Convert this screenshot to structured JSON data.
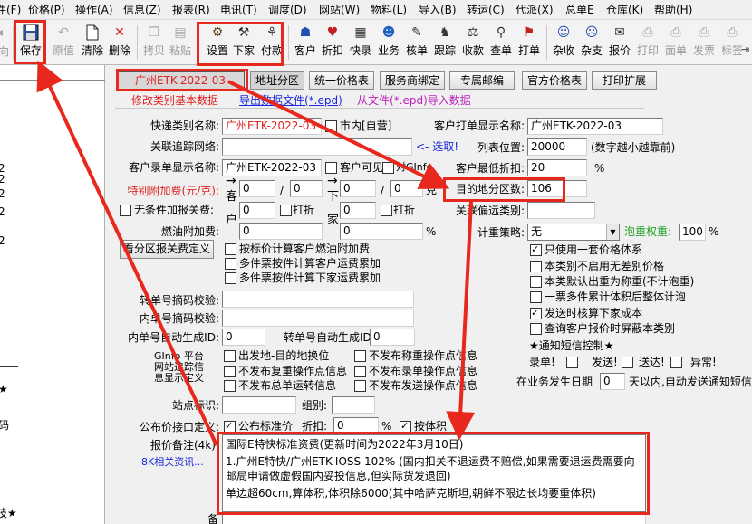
{
  "menu": [
    "件(F)",
    "价格(P)",
    "操作(A)",
    "信息(Z)",
    "报表(R)",
    "电讯(T)",
    "调度(D)",
    "网站(W)",
    "物料(L)",
    "导入(B)",
    "转运(C)",
    "代派(X)",
    "总单E",
    "仓库(K)",
    "帮助(H)"
  ],
  "toolbar": {
    "left_partial": "向",
    "buttons": [
      {
        "label": "保存",
        "icon": "floppy-icon",
        "enabled": true
      },
      {
        "label": "原值",
        "icon": "restore-icon",
        "enabled": false
      },
      {
        "label": "清除",
        "icon": "new-doc-icon",
        "enabled": true
      },
      {
        "label": "删除",
        "icon": "delete-icon",
        "enabled": true
      },
      {
        "label": "拷贝",
        "icon": "copy-icon",
        "enabled": false
      },
      {
        "label": "粘贴",
        "icon": "paste-icon",
        "enabled": false
      },
      {
        "label": "设置",
        "icon": "settings-icon",
        "enabled": true
      },
      {
        "label": "下家",
        "icon": "downstream-icon",
        "enabled": true
      },
      {
        "label": "付款",
        "icon": "payment-icon",
        "enabled": true
      },
      {
        "label": "客户",
        "icon": "customer-icon",
        "enabled": true
      },
      {
        "label": "折扣",
        "icon": "discount-icon",
        "enabled": true
      },
      {
        "label": "快录",
        "icon": "quick-entry-icon",
        "enabled": true
      },
      {
        "label": "业务",
        "icon": "business-icon",
        "enabled": true
      },
      {
        "label": "核单",
        "icon": "verify-icon",
        "enabled": true
      },
      {
        "label": "跟踪",
        "icon": "track-icon",
        "enabled": true
      },
      {
        "label": "收款",
        "icon": "receive-icon",
        "enabled": true
      },
      {
        "label": "查单",
        "icon": "query-icon",
        "enabled": true
      },
      {
        "label": "打单",
        "icon": "print-order-icon",
        "enabled": true
      },
      {
        "label": "杂收",
        "icon": "misc-income-icon",
        "enabled": true
      },
      {
        "label": "杂支",
        "icon": "misc-expense-icon",
        "enabled": true
      },
      {
        "label": "报价",
        "icon": "quote-icon",
        "enabled": true
      },
      {
        "label": "打印",
        "icon": "printer-icon",
        "enabled": false
      },
      {
        "label": "面单",
        "icon": "waybill-icon",
        "enabled": false
      },
      {
        "label": "发票",
        "icon": "invoice-icon",
        "enabled": false
      },
      {
        "label": "标签",
        "icon": "label-icon",
        "enabled": false
      }
    ]
  },
  "left_panel": {
    "fragments": [
      "2",
      "2",
      "2",
      "2",
      "2",
      "★",
      "码",
      "技★"
    ]
  },
  "tabs": {
    "current": "广州ETK-2022-03",
    "buttons": [
      "地址分区",
      "统一价格表",
      "服务商绑定",
      "专属邮编",
      "官方价格表",
      "打印扩展"
    ]
  },
  "links": {
    "edit_basic": "修改类别基本数据",
    "export": "导出数据文件(*.epd)",
    "import": "从文件(*.epd)导入数据"
  },
  "form": {
    "category_name_label": "快递类别名称:",
    "category_name": "广州ETK-2022-03",
    "city_internal_label": "市内[自营]",
    "print_name_label": "客户打单显示名称:",
    "print_name": "广州ETK-2022-03",
    "tracking_net_label": "关联追踪网络:",
    "tracking_net": "",
    "select_link": "<- 选取!",
    "list_pos_label": "列表位置:",
    "list_pos": "20000",
    "list_pos_hint": "(数字越小越靠前)",
    "entry_name_label": "客户录单显示名称:",
    "entry_name": "广州ETK-2022-03",
    "customer_visible_label": "客户可见",
    "ginfo_label": "对GInfo",
    "min_discount_label": "客户最低折扣:",
    "min_discount": "20",
    "percent": "%",
    "surcharge_label": "特别附加费(元/克):",
    "customer_short": "客",
    "downstream_short": "下",
    "surcharge_inputs": [
      "0",
      "0",
      "0",
      "0"
    ],
    "slash": "/",
    "gram": "克",
    "dest_zone_label": "目的地分区数:",
    "dest_zone_count": "106",
    "no_weight_surcharge_label": "无条件加报关费:",
    "household_short": "户",
    "home_short": "家",
    "customs_inputs": [
      "0",
      "0"
    ],
    "discount_label": "打折",
    "remote_category_label": "关联偏远类别:",
    "remote_category": "",
    "fuel_label": "燃油附加费:",
    "fuel_inputs": [
      "0",
      "0"
    ],
    "calc_strategy_label": "计重策略:",
    "calc_strategy": "无",
    "bubble_weight_label": "泡重权重:",
    "bubble_weight": "100",
    "zone_fee_button": "看分区报关费定义",
    "options_mid": [
      {
        "label": "按标价计算客户燃油附加费",
        "checked": false
      },
      {
        "label": "多件票按件计算客户运费累加",
        "checked": false
      },
      {
        "label": "多件票按件计算下家运费累加",
        "checked": false
      }
    ],
    "options_right": [
      {
        "label": "只使用一套价格体系",
        "checked": true
      },
      {
        "label": "本类别不启用无差别价格",
        "checked": false
      },
      {
        "label": "本类默认出重为称重(不计泡重)",
        "checked": false
      },
      {
        "label": "一票多件累计体积后整体计泡",
        "checked": false
      },
      {
        "label": "发送时核算下家成本",
        "checked": true
      },
      {
        "label": "查询客户报价时屏蔽本类别",
        "checked": false
      }
    ],
    "sms_label": "★通知短信控制★",
    "sms_options": [
      "录单!",
      "发送!",
      "送达!",
      "异常!"
    ],
    "auto_sms_prefix": "在业务发生日期",
    "auto_sms_days": "0",
    "auto_sms_suffix": "天以内,自动发送通知短信",
    "transfer_check_label": "转单号摘码校验:",
    "transfer_check": "",
    "internal_check_label": "内单号摘码校验:",
    "internal_check": "",
    "internal_auto_label": "内单号自动生成ID:",
    "internal_auto": "0",
    "transfer_auto_label": "转单号自动生成ID:",
    "transfer_auto": "0",
    "ginfo_platform_label": "GInfo 平台",
    "web_tracking_label": "网站追踪信",
    "info_display_label": "息显示定义",
    "tracking_opts": [
      {
        "label": "出发地-目的地换位",
        "checked": false
      },
      {
        "label": "不发布称重操作点信息",
        "checked": false
      },
      {
        "label": "不发布复重操作点信息",
        "checked": false
      },
      {
        "label": "不发布录单操作点信息",
        "checked": false
      },
      {
        "label": "不发布总单运转信息",
        "checked": false
      },
      {
        "label": "不发布发送操作点信息",
        "checked": false
      }
    ],
    "site_label": "站点标识:",
    "site": "",
    "group_label": "组别:",
    "group": "",
    "public_price_label": "公布价接口定义:",
    "public_std_label": "公布标准价",
    "public_std_checked": true,
    "discount_short": "折扣:",
    "public_discount": "0",
    "by_volume_label": "按体积",
    "by_volume_checked": true,
    "price_note_label": "报价备注(4k):",
    "related_info_link": "8K相关资讯...",
    "memo_lines": [
      "国际E特快标准资费(更新时间为2022年3月10日)",
      "1.广州E特快/广州ETK-IOSS 102%  (国内扣关不退运费不赔偿,如果需要退运费需要向邮局申请做虚假国内妥投信息,但实际货发退回)",
      "单边超60cm,算体积,体积除6000(其中哈萨克斯坦,朝鲜不限边长均要重体积)"
    ],
    "bottom_label": "备"
  }
}
